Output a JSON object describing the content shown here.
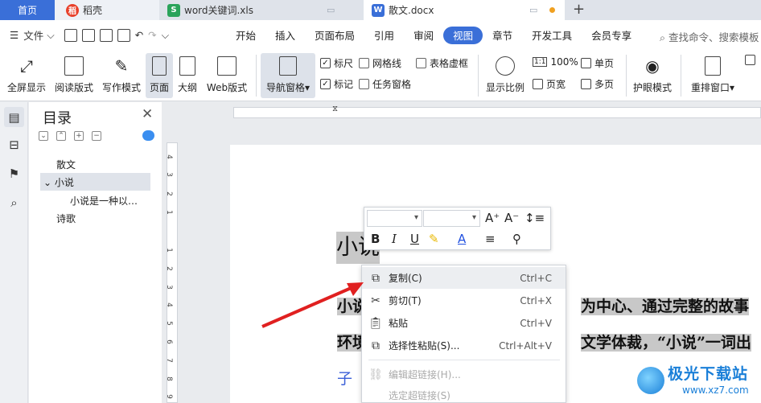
{
  "tabs": {
    "home": "首页",
    "daoke": "稻壳",
    "xls": "word关键词.xls",
    "doc": "散文.docx"
  },
  "menubar": {
    "file": "文件",
    "tabs": [
      "开始",
      "插入",
      "页面布局",
      "引用",
      "审阅",
      "视图",
      "章节",
      "开发工具",
      "会员专享"
    ],
    "active_tab": "视图",
    "search": "查找命令、搜索模板"
  },
  "ribbon": {
    "fullscreen": "全屏显示",
    "reading": "阅读版式",
    "writing": "写作模式",
    "page": "页面",
    "outline": "大纲",
    "web": "Web版式",
    "nav_pane": "导航窗格",
    "ruler": "标尺",
    "gridlines": "网格线",
    "table_lines": "表格虚框",
    "marks": "标记",
    "task_pane": "任务窗格",
    "zoom_ratio": "显示比例",
    "one_to_one": "1:1",
    "zoom_100": "100%",
    "single_page": "单页",
    "page_width": "页宽",
    "multi_page": "多页",
    "eye_mode": "护眼模式",
    "rearrange": "重排窗口"
  },
  "toc": {
    "title": "目录",
    "items": [
      "散文",
      "小说",
      "小说是一种以…",
      "诗歌"
    ]
  },
  "ruler_numbers": [
    "4",
    "3",
    "2",
    "1",
    "1",
    "2",
    "3",
    "4",
    "5",
    "6",
    "7",
    "8",
    "9"
  ],
  "document": {
    "heading": "小说",
    "line1_prefix": "小说",
    "line1_suffix": "为中心、通过完整的故事",
    "line2_prefix": "环境",
    "line2_suffix": "文学体裁，“小说”一词出",
    "line3": "子"
  },
  "context_menu": {
    "items": [
      {
        "label": "复制(C)",
        "key": "Ctrl+C"
      },
      {
        "label": "剪切(T)",
        "key": "Ctrl+X"
      },
      {
        "label": "粘贴",
        "key": "Ctrl+V"
      },
      {
        "label": "选择性粘贴(S)...",
        "key": "Ctrl+Alt+V"
      },
      {
        "label": "编辑超链接(H)...",
        "key": ""
      },
      {
        "label": "选定超链接(S)",
        "key": ""
      }
    ]
  },
  "watermark": {
    "title": "极光下载站",
    "url": "www.xz7.com"
  },
  "colors": {
    "accent": "#3a6fd8",
    "selection": "#c8c8c8",
    "arrow": "#e02020"
  }
}
